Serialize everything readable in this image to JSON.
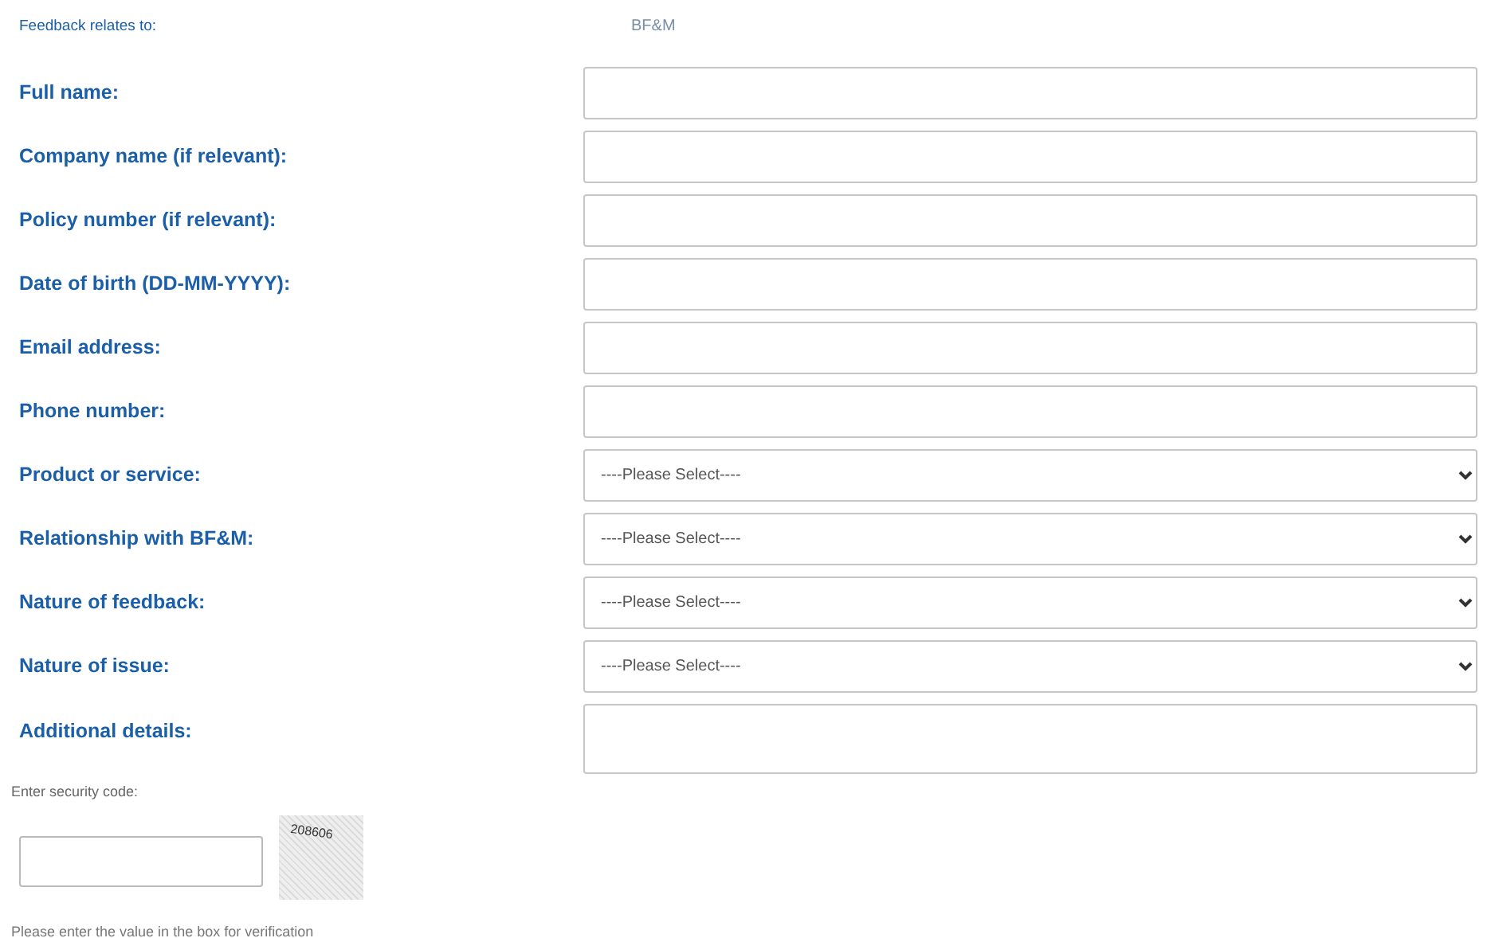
{
  "relates": {
    "label": "Feedback relates to:",
    "value": "BF&M"
  },
  "fields": [
    {
      "label": "Full name:",
      "kind": "text"
    },
    {
      "label": "Company name (if relevant):",
      "kind": "text"
    },
    {
      "label": "Policy number (if relevant):",
      "kind": "text"
    },
    {
      "label": "Date of birth (DD-MM-YYYY):",
      "kind": "text"
    },
    {
      "label": "Email address:",
      "kind": "text"
    },
    {
      "label": "Phone number:",
      "kind": "text"
    },
    {
      "label": "Product or service:",
      "kind": "select",
      "value": "----Please Select----"
    },
    {
      "label": "Relationship with BF&M:",
      "kind": "select",
      "value": "----Please Select----"
    },
    {
      "label": "Nature of feedback:",
      "kind": "select",
      "value": "----Please Select----"
    },
    {
      "label": "Nature of issue:",
      "kind": "select",
      "value": "----Please Select----"
    },
    {
      "label": "Additional details:",
      "kind": "textarea"
    }
  ],
  "security": {
    "label": "Enter security code:",
    "code": "208606",
    "hint": "Please enter the value in the box for verification"
  }
}
